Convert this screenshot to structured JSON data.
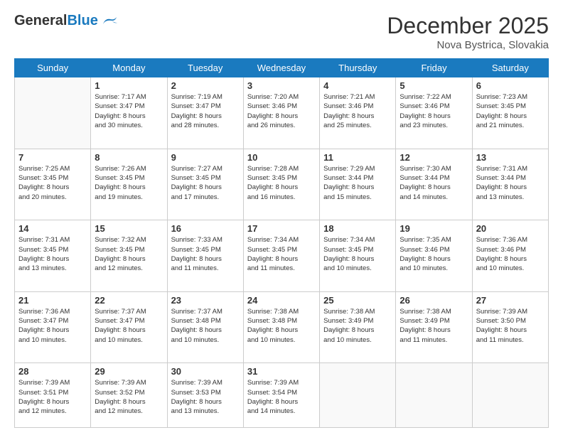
{
  "header": {
    "logo_general": "General",
    "logo_blue": "Blue",
    "month_year": "December 2025",
    "location": "Nova Bystrica, Slovakia"
  },
  "days_of_week": [
    "Sunday",
    "Monday",
    "Tuesday",
    "Wednesday",
    "Thursday",
    "Friday",
    "Saturday"
  ],
  "weeks": [
    [
      {
        "day": "",
        "info": ""
      },
      {
        "day": "1",
        "info": "Sunrise: 7:17 AM\nSunset: 3:47 PM\nDaylight: 8 hours\nand 30 minutes."
      },
      {
        "day": "2",
        "info": "Sunrise: 7:19 AM\nSunset: 3:47 PM\nDaylight: 8 hours\nand 28 minutes."
      },
      {
        "day": "3",
        "info": "Sunrise: 7:20 AM\nSunset: 3:46 PM\nDaylight: 8 hours\nand 26 minutes."
      },
      {
        "day": "4",
        "info": "Sunrise: 7:21 AM\nSunset: 3:46 PM\nDaylight: 8 hours\nand 25 minutes."
      },
      {
        "day": "5",
        "info": "Sunrise: 7:22 AM\nSunset: 3:46 PM\nDaylight: 8 hours\nand 23 minutes."
      },
      {
        "day": "6",
        "info": "Sunrise: 7:23 AM\nSunset: 3:45 PM\nDaylight: 8 hours\nand 21 minutes."
      }
    ],
    [
      {
        "day": "7",
        "info": "Sunrise: 7:25 AM\nSunset: 3:45 PM\nDaylight: 8 hours\nand 20 minutes."
      },
      {
        "day": "8",
        "info": "Sunrise: 7:26 AM\nSunset: 3:45 PM\nDaylight: 8 hours\nand 19 minutes."
      },
      {
        "day": "9",
        "info": "Sunrise: 7:27 AM\nSunset: 3:45 PM\nDaylight: 8 hours\nand 17 minutes."
      },
      {
        "day": "10",
        "info": "Sunrise: 7:28 AM\nSunset: 3:45 PM\nDaylight: 8 hours\nand 16 minutes."
      },
      {
        "day": "11",
        "info": "Sunrise: 7:29 AM\nSunset: 3:44 PM\nDaylight: 8 hours\nand 15 minutes."
      },
      {
        "day": "12",
        "info": "Sunrise: 7:30 AM\nSunset: 3:44 PM\nDaylight: 8 hours\nand 14 minutes."
      },
      {
        "day": "13",
        "info": "Sunrise: 7:31 AM\nSunset: 3:44 PM\nDaylight: 8 hours\nand 13 minutes."
      }
    ],
    [
      {
        "day": "14",
        "info": "Sunrise: 7:31 AM\nSunset: 3:45 PM\nDaylight: 8 hours\nand 13 minutes."
      },
      {
        "day": "15",
        "info": "Sunrise: 7:32 AM\nSunset: 3:45 PM\nDaylight: 8 hours\nand 12 minutes."
      },
      {
        "day": "16",
        "info": "Sunrise: 7:33 AM\nSunset: 3:45 PM\nDaylight: 8 hours\nand 11 minutes."
      },
      {
        "day": "17",
        "info": "Sunrise: 7:34 AM\nSunset: 3:45 PM\nDaylight: 8 hours\nand 11 minutes."
      },
      {
        "day": "18",
        "info": "Sunrise: 7:34 AM\nSunset: 3:45 PM\nDaylight: 8 hours\nand 10 minutes."
      },
      {
        "day": "19",
        "info": "Sunrise: 7:35 AM\nSunset: 3:46 PM\nDaylight: 8 hours\nand 10 minutes."
      },
      {
        "day": "20",
        "info": "Sunrise: 7:36 AM\nSunset: 3:46 PM\nDaylight: 8 hours\nand 10 minutes."
      }
    ],
    [
      {
        "day": "21",
        "info": "Sunrise: 7:36 AM\nSunset: 3:47 PM\nDaylight: 8 hours\nand 10 minutes."
      },
      {
        "day": "22",
        "info": "Sunrise: 7:37 AM\nSunset: 3:47 PM\nDaylight: 8 hours\nand 10 minutes."
      },
      {
        "day": "23",
        "info": "Sunrise: 7:37 AM\nSunset: 3:48 PM\nDaylight: 8 hours\nand 10 minutes."
      },
      {
        "day": "24",
        "info": "Sunrise: 7:38 AM\nSunset: 3:48 PM\nDaylight: 8 hours\nand 10 minutes."
      },
      {
        "day": "25",
        "info": "Sunrise: 7:38 AM\nSunset: 3:49 PM\nDaylight: 8 hours\nand 10 minutes."
      },
      {
        "day": "26",
        "info": "Sunrise: 7:38 AM\nSunset: 3:49 PM\nDaylight: 8 hours\nand 11 minutes."
      },
      {
        "day": "27",
        "info": "Sunrise: 7:39 AM\nSunset: 3:50 PM\nDaylight: 8 hours\nand 11 minutes."
      }
    ],
    [
      {
        "day": "28",
        "info": "Sunrise: 7:39 AM\nSunset: 3:51 PM\nDaylight: 8 hours\nand 12 minutes."
      },
      {
        "day": "29",
        "info": "Sunrise: 7:39 AM\nSunset: 3:52 PM\nDaylight: 8 hours\nand 12 minutes."
      },
      {
        "day": "30",
        "info": "Sunrise: 7:39 AM\nSunset: 3:53 PM\nDaylight: 8 hours\nand 13 minutes."
      },
      {
        "day": "31",
        "info": "Sunrise: 7:39 AM\nSunset: 3:54 PM\nDaylight: 8 hours\nand 14 minutes."
      },
      {
        "day": "",
        "info": ""
      },
      {
        "day": "",
        "info": ""
      },
      {
        "day": "",
        "info": ""
      }
    ]
  ]
}
